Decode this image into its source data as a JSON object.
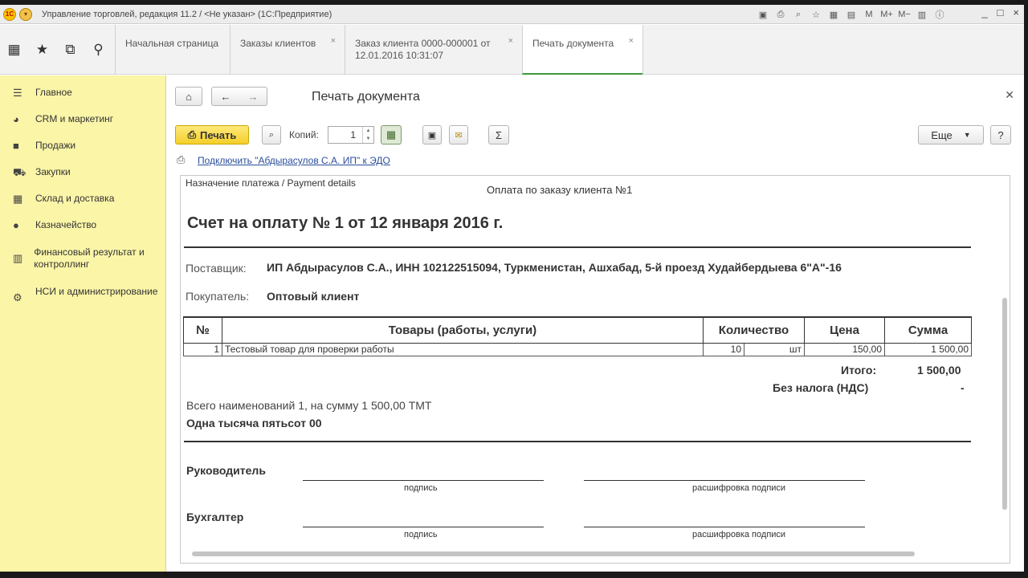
{
  "window": {
    "title": "Управление торговлей, редакция 11.2 / <Не указан>  (1С:Предприятие)",
    "logo_text": "1C",
    "controls": [
      "_",
      "□",
      "×"
    ],
    "toolbar_tools": [
      "M",
      "M+",
      "M−"
    ]
  },
  "tabs": [
    {
      "label": "Начальная страница",
      "closable": false
    },
    {
      "label": "Заказы клиентов",
      "closable": true
    },
    {
      "label": "Заказ клиента 0000-000001 от 12.01.2016 10:31:07",
      "closable": true
    },
    {
      "label": "Печать документа",
      "closable": true,
      "active": true
    }
  ],
  "sidebar": {
    "items": [
      {
        "label": "Главное",
        "icon": "menu-icon"
      },
      {
        "label": "CRM и маркетинг",
        "icon": "pie-chart-icon"
      },
      {
        "label": "Продажи",
        "icon": "bag-icon"
      },
      {
        "label": "Закупки",
        "icon": "cart-icon"
      },
      {
        "label": "Склад и доставка",
        "icon": "warehouse-icon"
      },
      {
        "label": "Казначейство",
        "icon": "coin-icon"
      },
      {
        "label": "Финансовый результат и контроллинг",
        "icon": "bar-chart-icon"
      },
      {
        "label": "НСИ и администрирование",
        "icon": "gear-icon"
      }
    ]
  },
  "form": {
    "title": "Печать документа",
    "print_label": "Печать",
    "copies_label": "Копий:",
    "copies_value": "1",
    "more_label": "Еще",
    "help_label": "?",
    "edo_link": "Подключить \"Абдырасулов С.А. ИП\" к ЭДО"
  },
  "doc": {
    "payment_details": "Назначение платежа / Payment details",
    "payment_purpose": "Оплата по заказу клиента №1",
    "heading": "Счет на оплату № 1 от 12 января 2016 г.",
    "supplier_label": "Поставщик:",
    "supplier_value": "ИП Абдырасулов С.А., ИНН 102122515094, Туркменистан, Ашхабад, 5-й проезд Худайбердыева 6\"А\"-16",
    "buyer_label": "Покупатель:",
    "buyer_value": "Оптовый клиент",
    "table": {
      "headers": [
        "№",
        "Товары (работы, услуги)",
        "Количество",
        "Цена",
        "Сумма"
      ],
      "rows": [
        {
          "num": "1",
          "name": "Тестовый товар для проверки работы",
          "qty": "10",
          "unit": "шт",
          "price": "150,00",
          "sum": "1 500,00"
        }
      ]
    },
    "total_label": "Итого:",
    "total_value": "1 500,00",
    "vat_label": "Без налога (НДС)",
    "vat_value": "-",
    "summary": "Всего наименований 1, на сумму 1 500,00 ТМТ",
    "amount_words": "Одна тысяча пятьсот  00",
    "head_label": "Руководитель",
    "accountant_label": "Бухгалтер",
    "signature_caption": "подпись",
    "decoding_caption": "расшифровка подписи"
  }
}
